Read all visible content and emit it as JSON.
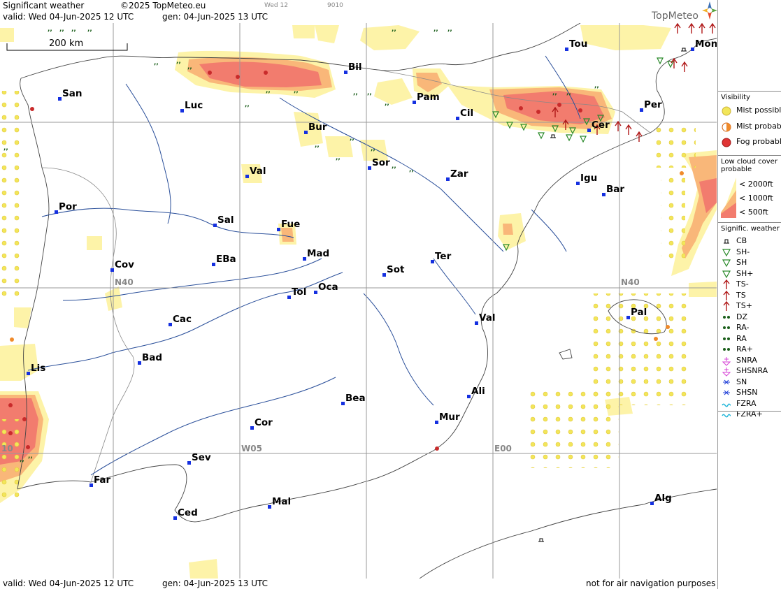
{
  "header": {
    "title": "Significant weather",
    "copyright": "©2025 TopMeteo.eu",
    "day_code": "Wed 12",
    "code": "9010",
    "valid": "valid:  Wed  04-Jun-2025  12 UTC",
    "gen": "gen: 04-Jun-2025 13 UTC",
    "logo_text": "TopMeteo"
  },
  "footer": {
    "valid": "valid:  Wed  04-Jun-2025  12 UTC",
    "gen": "gen: 04-Jun-2025 13 UTC",
    "disclaimer": "not for air navigation purposes"
  },
  "map": {
    "scale_label": "200 km",
    "grid_labels": [
      "N40",
      "N40",
      "W05",
      "E00",
      "10"
    ],
    "cities": [
      "Tou",
      "Mon",
      "Bil",
      "San",
      "Pam",
      "Luc",
      "Cil",
      "Per",
      "Cer",
      "Bur",
      "Sor",
      "Val",
      "Zar",
      "Igu",
      "Bar",
      "Por",
      "Sal",
      "Fue",
      "Mad",
      "Ter",
      "Cov",
      "EBa",
      "Sot",
      "Tol",
      "Oca",
      "Pal",
      "Cac",
      "Val",
      "Bad",
      "Lis",
      "Bea",
      "Ali",
      "Cor",
      "Mur",
      "Sev",
      "Far",
      "Mal",
      "Alg",
      "Ced"
    ]
  },
  "legend": {
    "visibility_title": "Visibility",
    "visibility": [
      {
        "label": "Mist possible",
        "color": "#f2e65a"
      },
      {
        "label": "Mist probable",
        "color": "#f08a2a"
      },
      {
        "label": "Fog probable",
        "color": "#e03535"
      }
    ],
    "lowcloud_title": "Low cloud cover probable",
    "lowcloud": [
      {
        "label": "< 2000ft",
        "color": "#fdf3a8"
      },
      {
        "label": "< 1000ft",
        "color": "#f9b779"
      },
      {
        "label": "<   500ft",
        "color": "#f27c6e"
      }
    ],
    "sigwx_title": "Signific. weather",
    "sigwx": [
      {
        "label": "CB",
        "icon": "cb-icon"
      },
      {
        "label": "SH-",
        "icon": "shower-light-icon"
      },
      {
        "label": "SH",
        "icon": "shower-icon"
      },
      {
        "label": "SH+",
        "icon": "shower-heavy-icon"
      },
      {
        "label": "TS-",
        "icon": "thunderstorm-light-icon"
      },
      {
        "label": "TS",
        "icon": "thunderstorm-icon"
      },
      {
        "label": "TS+",
        "icon": "thunderstorm-heavy-icon"
      },
      {
        "label": "DZ",
        "icon": "drizzle-icon"
      },
      {
        "label": "RA-",
        "icon": "rain-light-icon"
      },
      {
        "label": "RA",
        "icon": "rain-icon"
      },
      {
        "label": "RA+",
        "icon": "rain-heavy-icon"
      },
      {
        "label": "SNRA",
        "icon": "sleet-icon"
      },
      {
        "label": "SHSNRA",
        "icon": "sleet-shower-icon"
      },
      {
        "label": "SN",
        "icon": "snow-icon"
      },
      {
        "label": "SHSN",
        "icon": "snow-shower-icon"
      },
      {
        "label": "FZRA",
        "icon": "freezing-rain-icon"
      },
      {
        "label": "FZRA+",
        "icon": "freezing-rain-heavy-icon"
      }
    ]
  }
}
